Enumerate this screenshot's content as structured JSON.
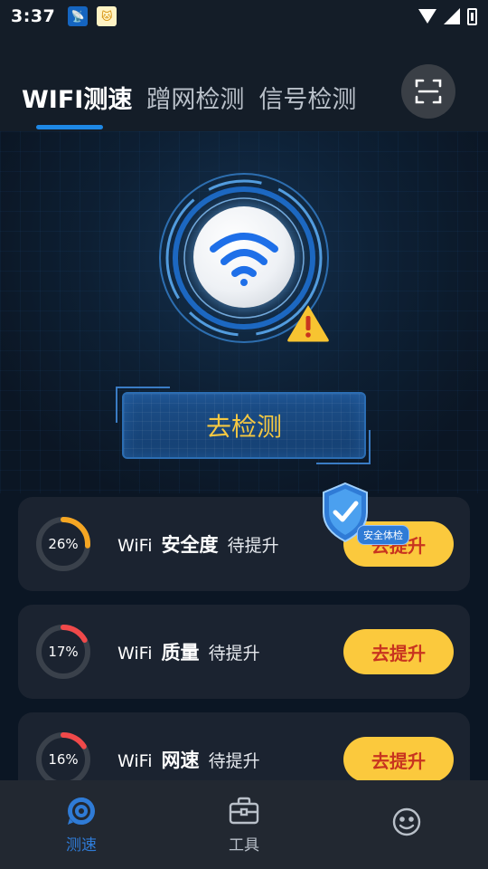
{
  "status_bar": {
    "time": "3:37",
    "notification_icons": [
      "broadcast-app-icon",
      "cat-app-icon"
    ],
    "system_icons": [
      "wifi-icon",
      "cellular-icon",
      "battery-charging-icon"
    ]
  },
  "header": {
    "tabs": [
      {
        "label": "WIFI测速",
        "active": true
      },
      {
        "label": "蹭网检测",
        "active": false
      },
      {
        "label": "信号检测",
        "active": false
      }
    ],
    "scan_icon": "scan-icon"
  },
  "hero": {
    "warning_icon": "warning-icon",
    "button_label": "去检测"
  },
  "cards": [
    {
      "percent": 26,
      "percent_label": "26%",
      "prefix": "WiFi",
      "metric": "安全度",
      "status": "待提升",
      "button": "去提升",
      "ring_color": "#f5a623"
    },
    {
      "percent": 17,
      "percent_label": "17%",
      "prefix": "WiFi",
      "metric": "质量",
      "status": "待提升",
      "button": "去提升",
      "ring_color": "#f0494a"
    },
    {
      "percent": 16,
      "percent_label": "16%",
      "prefix": "WiFi",
      "metric": "网速",
      "status": "待提升",
      "button": "去提升",
      "ring_color": "#f0494a"
    }
  ],
  "floating_badge": {
    "label": "安全体检",
    "icon": "shield-check-icon"
  },
  "bottom_nav": [
    {
      "label": "测速",
      "icon": "speed-icon",
      "active": true
    },
    {
      "label": "工具",
      "icon": "toolbox-icon",
      "active": false
    },
    {
      "label": "",
      "icon": "smiley-icon",
      "active": false
    }
  ],
  "colors": {
    "accent_blue": "#1e88e5",
    "button_yellow": "#fbc93d",
    "button_text_red": "#c8341f",
    "detect_text": "#f5c842"
  }
}
